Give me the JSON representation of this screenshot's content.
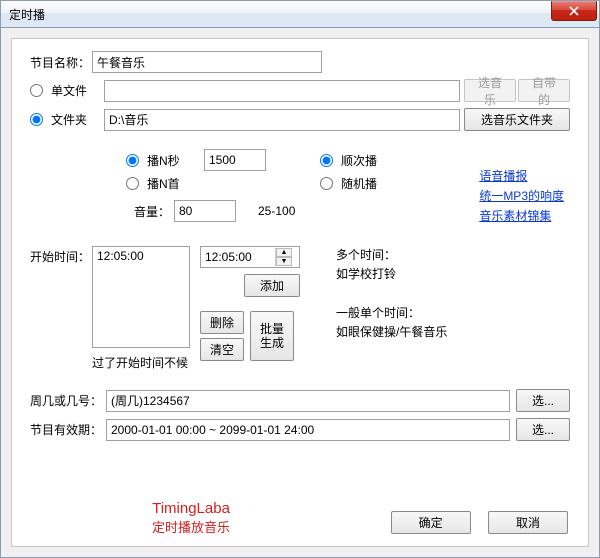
{
  "window": {
    "title": "定时播"
  },
  "programName": {
    "label": "节目名称：",
    "value": "午餐音乐"
  },
  "source": {
    "singleFile": {
      "label": "单文件",
      "value": "",
      "selectMusicBtn": "选音乐",
      "builtInBtn": "自带的"
    },
    "folder": {
      "label": "文件夹",
      "value": "D:\\音乐",
      "selectFolderBtn": "选音乐文件夹"
    }
  },
  "links": {
    "voice": "语音播报",
    "mp3gain": "统一MP3的响度",
    "musicLib": "音乐素材锦集"
  },
  "play": {
    "playNSecLabel": "播N秒",
    "playNSecValue": "1500",
    "playNSongLabel": "播N首",
    "orderLabel": "顺次播",
    "randomLabel": "随机播",
    "volumeLabel": "音量：",
    "volumeValue": "80",
    "volumeRange": "25-100"
  },
  "startTime": {
    "label": "开始时间：",
    "listValue": "12:05:00",
    "spinnerValue": "12:05:00",
    "addBtn": "添加",
    "deleteBtn": "删除",
    "clearBtn": "清空",
    "batchBtn": "批量\n生成",
    "lateNote": "过了开始时间不候"
  },
  "hints": {
    "multi1": "多个时间：",
    "multi2": "如学校打铃",
    "single1": "一般单个时间：",
    "single2": "如眼保健操/午餐音乐"
  },
  "weekday": {
    "label": "周几或几号：",
    "value": "(周几)1234567",
    "selectBtn": "选..."
  },
  "validity": {
    "label": "节目有效期：",
    "value": "2000-01-01 00:00 ~ 2099-01-01 24:00",
    "selectBtn": "选..."
  },
  "brand": {
    "en": "TimingLaba",
    "zh": "定时播放音乐"
  },
  "footer": {
    "ok": "确定",
    "cancel": "取消"
  }
}
